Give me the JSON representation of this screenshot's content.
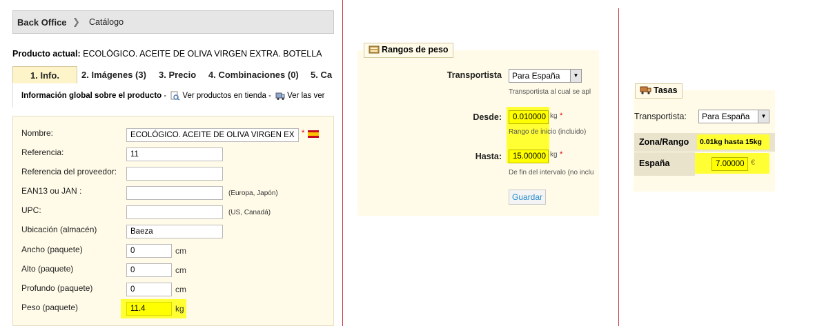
{
  "breadcrumb": {
    "root": "Back Office",
    "current": "Catálogo"
  },
  "product": {
    "label": "Producto actual:",
    "name": "ECOLÓGICO. ACEITE DE OLIVA VIRGEN EXTRA. BOTELLA"
  },
  "tabs": [
    {
      "label": "1. Info."
    },
    {
      "label": "2. Imágenes (3)"
    },
    {
      "label": "3. Precio"
    },
    {
      "label": "4. Combinaciones (0)"
    },
    {
      "label": "5. Ca"
    }
  ],
  "info_bar": {
    "title": "Información global sobre el producto",
    "link1": "Ver productos en tienda",
    "link2": "Ver las ver"
  },
  "form": {
    "nombre": {
      "label": "Nombre:",
      "value": "ECOLÓGICO. ACEITE DE OLIVA VIRGEN EX"
    },
    "referencia": {
      "label": "Referencia:",
      "value": "11"
    },
    "ref_proveedor": {
      "label": "Referencia del proveedor:",
      "value": ""
    },
    "ean": {
      "label": "EAN13 ou JAN :",
      "value": "",
      "hint": "(Europa, Japón)"
    },
    "upc": {
      "label": "UPC:",
      "value": "",
      "hint": "(US, Canadá)"
    },
    "ubicacion": {
      "label": "Ubicación (almacén)",
      "value": "Baeza"
    },
    "ancho": {
      "label": "Ancho (paquete)",
      "value": "0",
      "unit": "cm"
    },
    "alto": {
      "label": "Alto (paquete)",
      "value": "0",
      "unit": "cm"
    },
    "profundo": {
      "label": "Profundo (paquete)",
      "value": "0",
      "unit": "cm"
    },
    "peso": {
      "label": "Peso (paquete)",
      "value": "11.4",
      "unit": "kg"
    },
    "required_mark": "*"
  },
  "rangos": {
    "legend": "Rangos de peso",
    "transportista_label": "Transportista",
    "transportista_value": "Para España",
    "transportista_hint": "Transportista al cual se apl",
    "desde_label": "Desde:",
    "desde_value": "0.010000",
    "desde_unit": "kg",
    "desde_hint": "Rango de inicio (incluido)",
    "hasta_label": "Hasta:",
    "hasta_value": "15.00000",
    "hasta_unit": "kg",
    "hasta_hint": "De fin del intervalo (no inclu",
    "save_button": "Guardar"
  },
  "tasas": {
    "legend": "Tasas",
    "transportista_label": "Transportista:",
    "transportista_value": "Para España",
    "col_header": "Zona/Rango",
    "range_header": "0.01kg hasta 15kg",
    "row_label": "España",
    "row_value": "7.00000",
    "currency": "€"
  },
  "colors": {
    "highlight": "#ffff33",
    "divider": "#c8323a",
    "panel_bg": "#fffbe8"
  }
}
